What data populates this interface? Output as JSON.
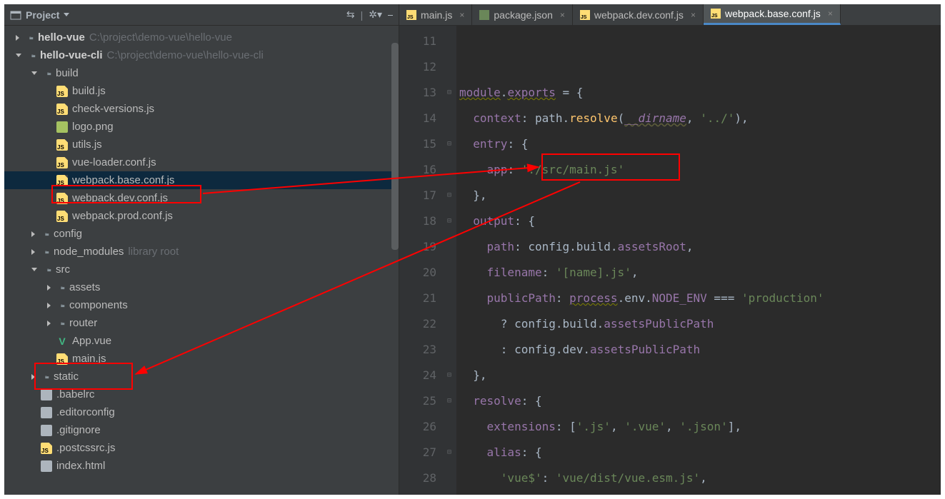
{
  "project": {
    "label": "Project"
  },
  "tree": [
    {
      "indent": 0,
      "arrow": "right",
      "icon": "folder",
      "label": "hello-vue",
      "hint": "C:\\project\\demo-vue\\hello-vue",
      "bold": true
    },
    {
      "indent": 0,
      "arrow": "down",
      "icon": "folder",
      "label": "hello-vue-cli",
      "hint": "C:\\project\\demo-vue\\hello-vue-cli",
      "bold": true
    },
    {
      "indent": 1,
      "arrow": "down",
      "icon": "folder-open",
      "label": "build"
    },
    {
      "indent": 2,
      "arrow": "none",
      "icon": "js",
      "label": "build.js"
    },
    {
      "indent": 2,
      "arrow": "none",
      "icon": "js",
      "label": "check-versions.js"
    },
    {
      "indent": 2,
      "arrow": "none",
      "icon": "png",
      "label": "logo.png"
    },
    {
      "indent": 2,
      "arrow": "none",
      "icon": "js",
      "label": "utils.js"
    },
    {
      "indent": 2,
      "arrow": "none",
      "icon": "js",
      "label": "vue-loader.conf.js"
    },
    {
      "indent": 2,
      "arrow": "none",
      "icon": "js",
      "label": "webpack.base.conf.js",
      "selected": true
    },
    {
      "indent": 2,
      "arrow": "none",
      "icon": "js",
      "label": "webpack.dev.conf.js"
    },
    {
      "indent": 2,
      "arrow": "none",
      "icon": "js",
      "label": "webpack.prod.conf.js"
    },
    {
      "indent": 1,
      "arrow": "right",
      "icon": "folder",
      "label": "config"
    },
    {
      "indent": 1,
      "arrow": "right",
      "icon": "folder",
      "label": "node_modules",
      "hint": "library root"
    },
    {
      "indent": 1,
      "arrow": "down",
      "icon": "folder-open",
      "label": "src"
    },
    {
      "indent": 2,
      "arrow": "right",
      "icon": "folder",
      "label": "assets"
    },
    {
      "indent": 2,
      "arrow": "right",
      "icon": "folder",
      "label": "components"
    },
    {
      "indent": 2,
      "arrow": "right",
      "icon": "folder",
      "label": "router"
    },
    {
      "indent": 2,
      "arrow": "none",
      "icon": "vue",
      "label": "App.vue"
    },
    {
      "indent": 2,
      "arrow": "none",
      "icon": "js",
      "label": "main.js"
    },
    {
      "indent": 1,
      "arrow": "right",
      "icon": "folder",
      "label": "static"
    },
    {
      "indent": 1,
      "arrow": "none",
      "icon": "txt",
      "label": ".babelrc"
    },
    {
      "indent": 1,
      "arrow": "none",
      "icon": "txt",
      "label": ".editorconfig"
    },
    {
      "indent": 1,
      "arrow": "none",
      "icon": "txt",
      "label": ".gitignore"
    },
    {
      "indent": 1,
      "arrow": "none",
      "icon": "js",
      "label": ".postcssrc.js"
    },
    {
      "indent": 1,
      "arrow": "none",
      "icon": "txt",
      "label": "index.html"
    }
  ],
  "tabs": [
    {
      "icon": "js",
      "label": "main.js"
    },
    {
      "icon": "json",
      "label": "package.json"
    },
    {
      "icon": "js",
      "label": "webpack.dev.conf.js"
    },
    {
      "icon": "js",
      "label": "webpack.base.conf.js",
      "active": true
    }
  ],
  "code": {
    "first_line_number": 11,
    "lines": [
      "",
      "",
      "module.exports = {",
      "  context: path.resolve(__dirname, '../'),",
      "  entry: {",
      "    app: './src/main.js'",
      "  },",
      "  output: {",
      "    path: config.build.assetsRoot,",
      "    filename: '[name].js',",
      "    publicPath: process.env.NODE_ENV === 'production'",
      "      ? config.build.assetsPublicPath",
      "      : config.dev.assetsPublicPath",
      "  },",
      "  resolve: {",
      "    extensions: ['.js', '.vue', '.json'],",
      "    alias: {",
      "      'vue$': 'vue/dist/vue.esm.js',"
    ],
    "folds": [
      "",
      "",
      "⊟",
      "",
      "⊟",
      "",
      "⊟",
      "⊟",
      "",
      "",
      "",
      "",
      "",
      "⊟",
      "⊟",
      "",
      "⊟",
      ""
    ]
  },
  "colors": {
    "accent": "#4a88c7",
    "red": "#ff0000"
  }
}
